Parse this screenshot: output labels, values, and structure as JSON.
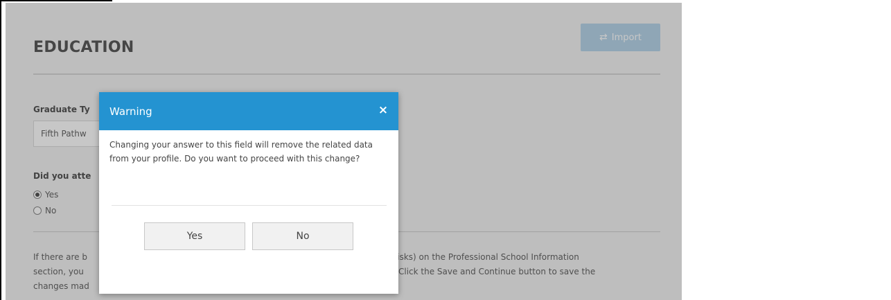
{
  "section": {
    "title": "EDUCATION",
    "import_label": "Import"
  },
  "form": {
    "graduate_type_label": "Graduate Ty",
    "graduate_type_value": "Fifth Pathw",
    "attend_question_label": "Did you atte",
    "radio_options": [
      {
        "label": "Yes",
        "checked": true
      },
      {
        "label": "No",
        "checked": false
      }
    ],
    "info_lines": [
      {
        "left": "If there are b",
        "right": "sterisks) on the Professional School Information"
      },
      {
        "left": "section, you",
        "right": "Click the Save and Continue button to save the"
      },
      {
        "left": "changes mad",
        "right": ""
      }
    ]
  },
  "modal": {
    "title": "Warning",
    "close_symbol": "×",
    "message": "Changing your answer to this field will remove the related data from your profile. Do you want to proceed with this change?",
    "yes_label": "Yes",
    "no_label": "No"
  },
  "colors": {
    "modal_header": "#2493d1",
    "import_button": "#b8d5e9",
    "overlay": "rgba(0,0,0,0.22)"
  }
}
